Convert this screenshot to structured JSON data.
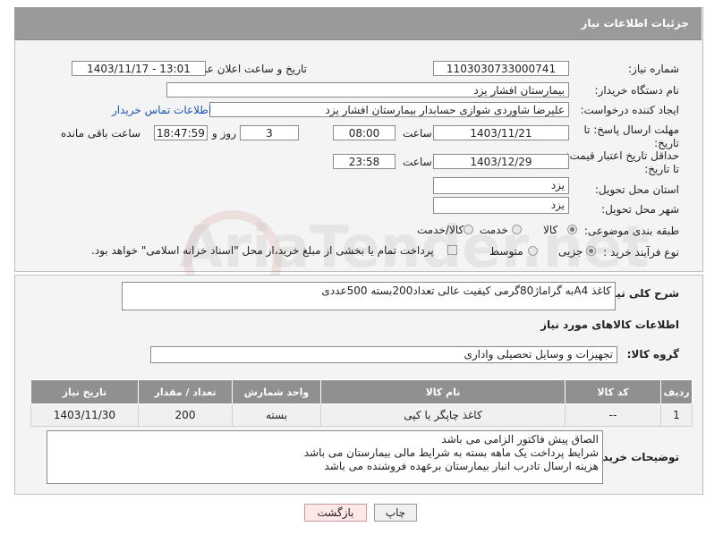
{
  "header": {
    "title": "جزئیات اطلاعات نیاز"
  },
  "form": {
    "need_number_label": "شماره نیاز:",
    "need_number": "1103030733000741",
    "announce_label": "تاریخ و ساعت اعلان عمومی:",
    "announce_value": "1403/11/17 - 13:01",
    "buyer_org_label": "نام دستگاه خریدار:",
    "buyer_org": "بیمارستان افشار یزد",
    "creator_label": "ایجاد کننده درخواست:",
    "creator": "علیرضا شاوردی شوازی حسابدار بیمارستان افشار یزد",
    "contact_link": "اطلاعات تماس خریدار",
    "deadline_label": "مهلت ارسال پاسخ: تا تاریخ:",
    "deadline_date": "1403/11/21",
    "time_label": "ساعت",
    "deadline_time": "08:00",
    "days_value": "3",
    "days_label": "روز و",
    "remaining_time": "18:47:59",
    "remaining_label": "ساعت باقی مانده",
    "validity_label": "حداقل تاریخ اعتبار قیمت: تا تاریخ:",
    "validity_date": "1403/12/29",
    "validity_time": "23:58",
    "province_label": "استان محل تحویل:",
    "province": "یزد",
    "city_label": "شهر محل تحویل:",
    "city": "یزد",
    "category_label": "طبقه بندی موضوعی:",
    "category_options": [
      "کالا",
      "خدمت",
      "کالا/خدمت"
    ],
    "process_label": "نوع فرآیند خرید :",
    "process_options": [
      "جزیی",
      "متوسط"
    ],
    "payment_note": "پرداخت تمام یا بخشی از مبلغ خرید،از محل \"اسناد خزانه اسلامی\" خواهد بود."
  },
  "details": {
    "description_label": "شرح کلی نیاز:",
    "description": "کاغذ A4به گراماژ80گرمی کیفیت عالی تعداد200بسته 500عددی",
    "goods_info_title": "اطلاعات کالاهای مورد نیاز",
    "group_label": "گروه کالا:",
    "group_value": "تجهیزات و وسایل تحصیلی واداری"
  },
  "table": {
    "headers": [
      "ردیف",
      "کد کالا",
      "نام کالا",
      "واحد شمارش",
      "تعداد / مقدار",
      "تاریخ نیاز"
    ],
    "rows": [
      [
        "1",
        "--",
        "کاغذ چاپگر یا کپی",
        "بسته",
        "200",
        "1403/11/30"
      ]
    ]
  },
  "buyer_notes": {
    "label": "توضیحات خریدار:",
    "text": "الصاق پیش فاکتور الزامی می باشد\nشرایط پرداخت  یک ماهه بسته به شرایط مالی بیمارستان می باشد\nهزینه ارسال تادرب انبار بیمارستان برعهده فروشنده می باشد"
  },
  "buttons": {
    "print": "چاپ",
    "back": "بازگشت"
  },
  "watermark": "AriaTender.net",
  "colors": {
    "header": "#9a9a9a",
    "link": "#1a55b5",
    "table_header": "#909090"
  }
}
